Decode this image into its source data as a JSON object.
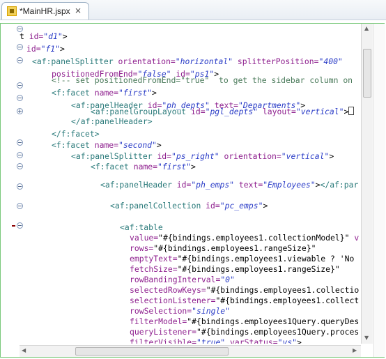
{
  "tab": {
    "title": "*MainHR.jspx",
    "close_glyph": "⨯"
  },
  "code": {
    "l1": [
      [
        "t ",
        "plain"
      ],
      [
        "id=",
        "attr"
      ],
      [
        "\"d1\"",
        "val"
      ],
      [
        ">",
        "plain"
      ]
    ],
    "l2": [
      [
        "id=",
        "attr"
      ],
      [
        "\"f1\"",
        "val"
      ],
      [
        ">",
        "plain"
      ]
    ],
    "l3": [
      [
        "<af:panelSplitter ",
        "tag"
      ],
      [
        "orientation=",
        "attr"
      ],
      [
        "\"horizontal\"",
        "val"
      ],
      [
        " ",
        "plain"
      ],
      [
        "splitterPosition=",
        "attr"
      ],
      [
        "\"400\"",
        "val"
      ]
    ],
    "l4": [
      [
        "positionedFromEnd=",
        "attr"
      ],
      [
        "\"false\"",
        "val"
      ],
      [
        " ",
        "plain"
      ],
      [
        "id=",
        "attr"
      ],
      [
        "\"ps1\"",
        "val"
      ],
      [
        ">",
        "plain"
      ]
    ],
    "l5": [
      [
        "<!-- set positionedFromEnd=\"true\"  to get the sidebar column on",
        "cmt"
      ]
    ],
    "l6": [
      [
        "<f:facet ",
        "tag"
      ],
      [
        "name=",
        "attr"
      ],
      [
        "\"first\"",
        "val"
      ],
      [
        ">",
        "plain"
      ]
    ],
    "l7": [
      [
        "<af:panelHeader ",
        "tag"
      ],
      [
        "id=",
        "attr"
      ],
      [
        "\"ph_depts\"",
        "val"
      ],
      [
        " ",
        "plain"
      ],
      [
        "text=",
        "attr"
      ],
      [
        "\"Departments\"",
        "val"
      ],
      [
        ">",
        "plain"
      ]
    ],
    "l8": [
      [
        "<af:panelGroupLayout ",
        "tag"
      ],
      [
        "id=",
        "attr"
      ],
      [
        "\"pgl_depts\"",
        "val"
      ],
      [
        " ",
        "plain"
      ],
      [
        "layout=",
        "attr"
      ],
      [
        "\"vertical\"",
        "val"
      ],
      [
        ">",
        "plain"
      ]
    ],
    "l9": [
      [
        "</af:panelHeader>",
        "tag"
      ]
    ],
    "l10": [
      [
        "</f:facet>",
        "tag"
      ]
    ],
    "l11": [
      [
        "<f:facet ",
        "tag"
      ],
      [
        "name=",
        "attr"
      ],
      [
        "\"second\"",
        "val"
      ],
      [
        ">",
        "plain"
      ]
    ],
    "l12": [
      [
        "<af:panelSplitter ",
        "tag"
      ],
      [
        "id=",
        "attr"
      ],
      [
        "\"ps_right\"",
        "val"
      ],
      [
        " ",
        "plain"
      ],
      [
        "orientation=",
        "attr"
      ],
      [
        "\"vertical\"",
        "val"
      ],
      [
        ">",
        "plain"
      ]
    ],
    "l13": [
      [
        "<f:facet ",
        "tag"
      ],
      [
        "name=",
        "attr"
      ],
      [
        "\"first\"",
        "val"
      ],
      [
        ">",
        "plain"
      ]
    ],
    "l14": [
      [
        "<af:panelHeader ",
        "tag"
      ],
      [
        "id=",
        "attr"
      ],
      [
        "\"ph_emps\"",
        "val"
      ],
      [
        " ",
        "plain"
      ],
      [
        "text=",
        "attr"
      ],
      [
        "\"Employees\"",
        "val"
      ],
      [
        ">",
        "plain"
      ],
      [
        "</af:par",
        "tag"
      ]
    ],
    "l15": [
      [
        "<af:panelCollection ",
        "tag"
      ],
      [
        "id=",
        "attr"
      ],
      [
        "\"pc_emps\"",
        "val"
      ],
      [
        ">",
        "plain"
      ]
    ],
    "l16": [
      [
        "<af:table",
        "tag"
      ]
    ],
    "l17": [
      [
        "value=",
        "attr"
      ],
      [
        "\"#{bindings.employees1.collectionModel}\"",
        "plain"
      ],
      [
        " v",
        "attr"
      ]
    ],
    "l18": [
      [
        "rows=",
        "attr"
      ],
      [
        "\"#{bindings.employees1.rangeSize}\"",
        "plain"
      ]
    ],
    "l19": [
      [
        "emptyText=",
        "attr"
      ],
      [
        "\"#{bindings.employees1.viewable ? 'No",
        "plain"
      ]
    ],
    "l20": [
      [
        "fetchSize=",
        "attr"
      ],
      [
        "\"#{bindings.employees1.rangeSize}\"",
        "plain"
      ]
    ],
    "l21": [
      [
        "rowBandingInterval=",
        "attr"
      ],
      [
        "\"0\"",
        "val"
      ]
    ],
    "l22": [
      [
        "selectedRowKeys=",
        "attr"
      ],
      [
        "\"#{bindings.employees1.collectio",
        "plain"
      ]
    ],
    "l23": [
      [
        "selectionListener=",
        "attr"
      ],
      [
        "\"#{bindings.employees1.collect",
        "plain"
      ]
    ],
    "l24": [
      [
        "rowSelection=",
        "attr"
      ],
      [
        "\"single\"",
        "val"
      ]
    ],
    "l25": [
      [
        "filterModel=",
        "attr"
      ],
      [
        "\"#{bindings.employees1Query.queryDes",
        "plain"
      ]
    ],
    "l26": [
      [
        "queryListener=",
        "attr"
      ],
      [
        "\"#{bindings.employees1Query.proces",
        "plain"
      ]
    ],
    "l27": [
      [
        "filterVisible=",
        "attr"
      ],
      [
        "\"true\"",
        "val"
      ],
      [
        " ",
        "plain"
      ],
      [
        "varStatus=",
        "attr"
      ],
      [
        "\"vs\"",
        "val"
      ],
      [
        ">",
        "plain"
      ]
    ]
  },
  "scroll": {
    "up": "▲",
    "down": "▼",
    "left": "◀",
    "right": "▶"
  },
  "colors": {
    "tag": "#2a7a7a",
    "attr": "#8e1f8e",
    "value": "#2a3cc7",
    "comment": "#4a7a5a",
    "active_border": "#79c87a"
  }
}
